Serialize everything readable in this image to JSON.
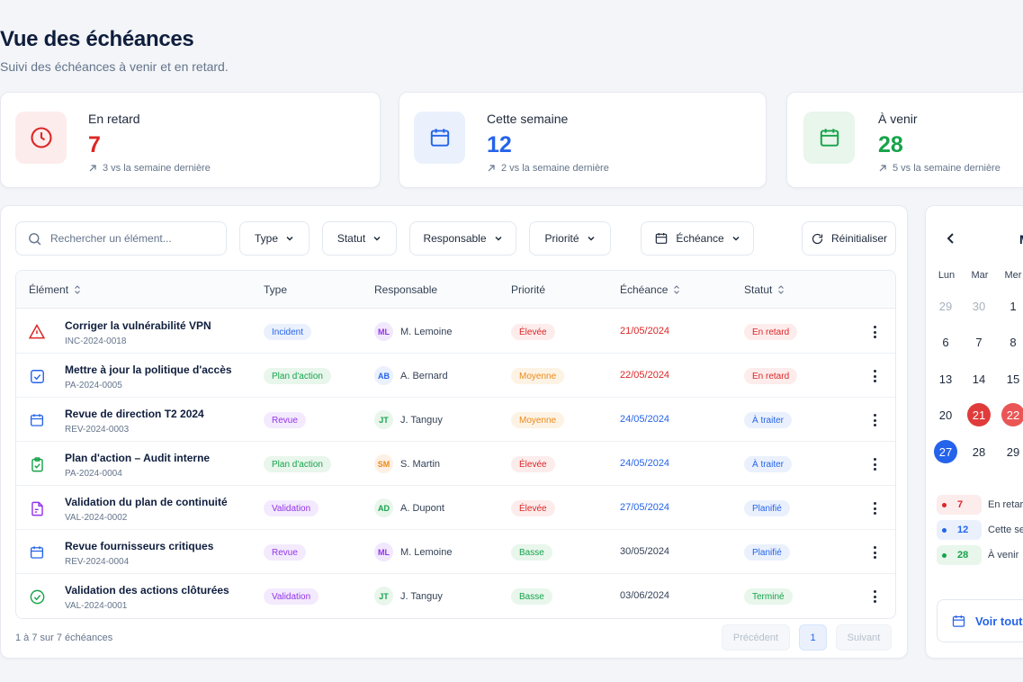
{
  "page": {
    "title": "Vue des échéances",
    "subtitle": "Suivi des échéances à venir et en retard."
  },
  "stats": [
    {
      "label": "En retard",
      "value": "7",
      "trend": "3 vs la semaine dernière",
      "icon": "clock-icon",
      "color": "#dc2626",
      "bg": "#fdecec"
    },
    {
      "label": "Cette semaine",
      "value": "12",
      "trend": "2 vs la semaine dernière",
      "icon": "calendar-icon",
      "color": "#2563eb",
      "bg": "#eaf1fd"
    },
    {
      "label": "À venir",
      "value": "28",
      "trend": "5 vs la semaine dernière",
      "icon": "calendar-icon",
      "color": "#16a34a",
      "bg": "#e8f6ec"
    }
  ],
  "filters": {
    "search_placeholder": "Rechercher un élément...",
    "type": "Type",
    "status": "Statut",
    "owner": "Responsable",
    "priority": "Priorité",
    "due": "Échéance",
    "reset": "Réinitialiser"
  },
  "table": {
    "headers": {
      "element": "Élément",
      "type": "Type",
      "owner": "Responsable",
      "priority": "Priorité",
      "due": "Échéance",
      "status": "Statut"
    },
    "rows": [
      {
        "title": "Corriger la vulnérabilité VPN",
        "ref": "INC-2024-0018",
        "icon": "warning-triangle-icon",
        "type": "Incident",
        "initials": "ML",
        "owner": "M. Lemoine",
        "priority": "Élevée",
        "due": "21/05/2024",
        "status": "En retard"
      },
      {
        "title": "Mettre à jour la politique d'accès",
        "ref": "PA-2024-0005",
        "icon": "checklist-icon",
        "type": "Plan d'action",
        "initials": "AB",
        "owner": "A. Bernard",
        "priority": "Moyenne",
        "due": "22/05/2024",
        "status": "En retard"
      },
      {
        "title": "Revue de direction T2 2024",
        "ref": "REV-2024-0003",
        "icon": "calendar-icon",
        "type": "Revue",
        "initials": "JT",
        "owner": "J. Tanguy",
        "priority": "Moyenne",
        "due": "24/05/2024",
        "status": "À traiter"
      },
      {
        "title": "Plan d'action – Audit interne",
        "ref": "PA-2024-0004",
        "icon": "clipboard-icon",
        "type": "Plan d'action",
        "initials": "SM",
        "owner": "S. Martin",
        "priority": "Élevée",
        "due": "24/05/2024",
        "status": "À traiter"
      },
      {
        "title": "Validation du plan de continuité",
        "ref": "VAL-2024-0002",
        "icon": "document-edit-icon",
        "type": "Validation",
        "initials": "AD",
        "owner": "A. Dupont",
        "priority": "Élevée",
        "due": "27/05/2024",
        "status": "Planifié"
      },
      {
        "title": "Revue fournisseurs critiques",
        "ref": "REV-2024-0004",
        "icon": "calendar-icon",
        "type": "Revue",
        "initials": "ML",
        "owner": "M. Lemoine",
        "priority": "Basse",
        "due": "30/05/2024",
        "status": "Planifié"
      },
      {
        "title": "Validation des actions clôturées",
        "ref": "VAL-2024-0001",
        "icon": "check-circle-icon",
        "type": "Validation",
        "initials": "JT",
        "owner": "J. Tanguy",
        "priority": "Basse",
        "due": "03/06/2024",
        "status": "Terminé"
      }
    ]
  },
  "pagination": {
    "summary": "1 à 7 sur 7 échéances",
    "prev": "Précédent",
    "page": "1",
    "next": "Suivant"
  },
  "calendar": {
    "month_label": "M",
    "weekdays": [
      "Lun",
      "Mar",
      "Mer"
    ],
    "weeks": [
      [
        "29",
        "30",
        "1"
      ],
      [
        "6",
        "7",
        "8"
      ],
      [
        "13",
        "14",
        "15"
      ],
      [
        "20",
        "21",
        "22"
      ],
      [
        "27",
        "28",
        "29"
      ]
    ],
    "legend": [
      {
        "count": "7",
        "label": "En retard"
      },
      {
        "count": "12",
        "label": "Cette se"
      },
      {
        "count": "28",
        "label": "À venir"
      }
    ],
    "see_all": "Voir toute"
  },
  "colors": {
    "red": "#dc2626",
    "blue": "#2563eb",
    "green": "#16a34a",
    "orange": "#ea8a1a",
    "purple": "#9333ea"
  }
}
